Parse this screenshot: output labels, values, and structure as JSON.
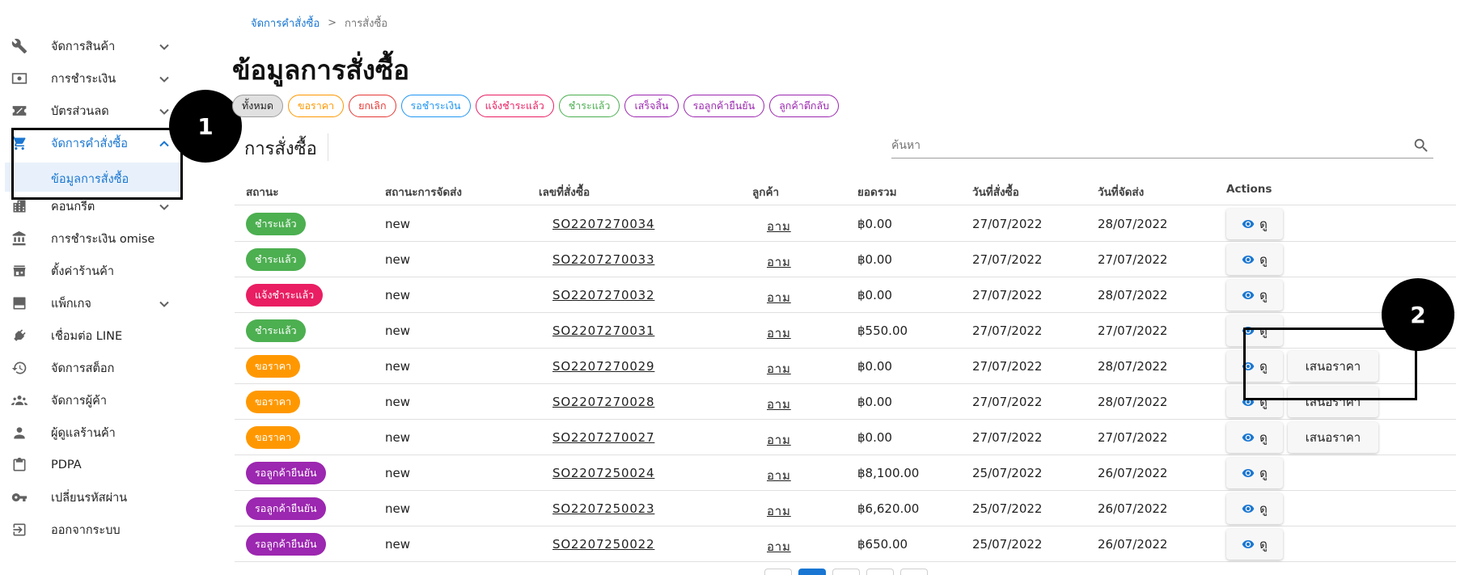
{
  "sidebar": {
    "items": [
      {
        "label": "จัดการสินค้า",
        "icon": "tools-icon",
        "has_chevron": true
      },
      {
        "label": "การชำระเงิน",
        "icon": "payments-icon",
        "has_chevron": true
      },
      {
        "label": "บัตรส่วนลด",
        "icon": "discount-icon",
        "has_chevron": true
      },
      {
        "label": "จัดการคำสั่งซื้อ",
        "icon": "cart-icon",
        "has_chevron": true,
        "active": true
      },
      {
        "label": "คอนกรีต",
        "icon": "building-icon",
        "has_chevron": true
      },
      {
        "label": "การชำระเงิน omise",
        "icon": "bank-icon",
        "has_chevron": false
      },
      {
        "label": "ตั้งค่าร้านค้า",
        "icon": "store-icon",
        "has_chevron": false
      },
      {
        "label": "แพ็กเกจ",
        "icon": "package-icon",
        "has_chevron": true
      },
      {
        "label": "เชื่อมต่อ LINE",
        "icon": "plug-icon",
        "has_chevron": false
      },
      {
        "label": "จัดการสต็อก",
        "icon": "stock-icon",
        "has_chevron": false
      },
      {
        "label": "จัดการผู้ค้า",
        "icon": "group-icon",
        "has_chevron": false
      },
      {
        "label": "ผู้ดูแลร้านค้า",
        "icon": "person-icon",
        "has_chevron": false
      },
      {
        "label": "PDPA",
        "icon": "clipboard-icon",
        "has_chevron": false
      },
      {
        "label": "เปลี่ยนรหัสผ่าน",
        "icon": "key-icon",
        "has_chevron": false
      },
      {
        "label": "ออกจากระบบ",
        "icon": "logout-icon",
        "has_chevron": false
      }
    ],
    "sub_item": {
      "label": "ข้อมูลการสั่งซื้อ"
    }
  },
  "callouts": {
    "one": "1",
    "two": "2"
  },
  "breadcrumb": {
    "link": "จัดการคำสั่งซื้อ",
    "separator": ">",
    "current": "การสั่งซื้อ"
  },
  "page_title": "ข้อมูลการสั่งซื้อ",
  "filters": [
    {
      "label": "ทั้งหมด",
      "color": "#9e9e9e",
      "bg": "#e0e0e0",
      "text": "#212121"
    },
    {
      "label": "ขอราคา",
      "color": "#ff9800",
      "bg": "#ffffff",
      "text": "#ff9800"
    },
    {
      "label": "ยกเลิก",
      "color": "#e53935",
      "bg": "#ffffff",
      "text": "#e53935"
    },
    {
      "label": "รอชำระเงิน",
      "color": "#2196f3",
      "bg": "#ffffff",
      "text": "#2196f3"
    },
    {
      "label": "แจ้งชำระแล้ว",
      "color": "#e91e63",
      "bg": "#ffffff",
      "text": "#e91e63"
    },
    {
      "label": "ชำระแล้ว",
      "color": "#4caf50",
      "bg": "#ffffff",
      "text": "#4caf50"
    },
    {
      "label": "เสร็จสิ้น",
      "color": "#9c27b0",
      "bg": "#ffffff",
      "text": "#9c27b0"
    },
    {
      "label": "รอลูกค้ายืนยัน",
      "color": "#9c27b0",
      "bg": "#ffffff",
      "text": "#9c27b0"
    },
    {
      "label": "ลูกค้าตีกลับ",
      "color": "#9c27b0",
      "bg": "#ffffff",
      "text": "#9c27b0"
    }
  ],
  "card": {
    "title": "การสั่งซื้อ"
  },
  "search": {
    "placeholder": "ค้นหา",
    "value": ""
  },
  "table": {
    "headers": [
      "สถานะ",
      "สถานะการจัดส่ง",
      "เลขที่สั่งซื้อ",
      "ลูกค้า",
      "ยอดรวม",
      "วันที่สั่งซื้อ",
      "วันที่จัดส่ง",
      "Actions"
    ],
    "view_label": "ดู",
    "quote_label": "เสนอราคา",
    "rows": [
      {
        "status": "ชำระแล้ว",
        "status_color": "#4caf50",
        "shipping": "new",
        "order_no": "SO2207270034",
        "customer": "อาม",
        "total": "฿0.00",
        "order_date": "27/07/2022",
        "ship_date": "28/07/2022",
        "quote": false
      },
      {
        "status": "ชำระแล้ว",
        "status_color": "#4caf50",
        "shipping": "new",
        "order_no": "SO2207270033",
        "customer": "อาม",
        "total": "฿0.00",
        "order_date": "27/07/2022",
        "ship_date": "27/07/2022",
        "quote": false
      },
      {
        "status": "แจ้งชำระแล้ว",
        "status_color": "#e91e63",
        "shipping": "new",
        "order_no": "SO2207270032",
        "customer": "อาม",
        "total": "฿0.00",
        "order_date": "27/07/2022",
        "ship_date": "28/07/2022",
        "quote": false
      },
      {
        "status": "ชำระแล้ว",
        "status_color": "#4caf50",
        "shipping": "new",
        "order_no": "SO2207270031",
        "customer": "อาม",
        "total": "฿550.00",
        "order_date": "27/07/2022",
        "ship_date": "27/07/2022",
        "quote": false
      },
      {
        "status": "ขอราคา",
        "status_color": "#ff9800",
        "shipping": "new",
        "order_no": "SO2207270029",
        "customer": "อาม",
        "total": "฿0.00",
        "order_date": "27/07/2022",
        "ship_date": "28/07/2022",
        "quote": true
      },
      {
        "status": "ขอราคา",
        "status_color": "#ff9800",
        "shipping": "new",
        "order_no": "SO2207270028",
        "customer": "อาม",
        "total": "฿0.00",
        "order_date": "27/07/2022",
        "ship_date": "28/07/2022",
        "quote": true
      },
      {
        "status": "ขอราคา",
        "status_color": "#ff9800",
        "shipping": "new",
        "order_no": "SO2207270027",
        "customer": "อาม",
        "total": "฿0.00",
        "order_date": "27/07/2022",
        "ship_date": "27/07/2022",
        "quote": true
      },
      {
        "status": "รอลูกค้ายืนยัน",
        "status_color": "#9c27b0",
        "shipping": "new",
        "order_no": "SO2207250024",
        "customer": "อาม",
        "total": "฿8,100.00",
        "order_date": "25/07/2022",
        "ship_date": "26/07/2022",
        "quote": false
      },
      {
        "status": "รอลูกค้ายืนยัน",
        "status_color": "#9c27b0",
        "shipping": "new",
        "order_no": "SO2207250023",
        "customer": "อาม",
        "total": "฿6,620.00",
        "order_date": "25/07/2022",
        "ship_date": "26/07/2022",
        "quote": false
      },
      {
        "status": "รอลูกค้ายืนยัน",
        "status_color": "#9c27b0",
        "shipping": "new",
        "order_no": "SO2207250022",
        "customer": "อาม",
        "total": "฿650.00",
        "order_date": "25/07/2022",
        "ship_date": "26/07/2022",
        "quote": false
      }
    ]
  },
  "theme": {
    "accent": "#1976d2"
  }
}
